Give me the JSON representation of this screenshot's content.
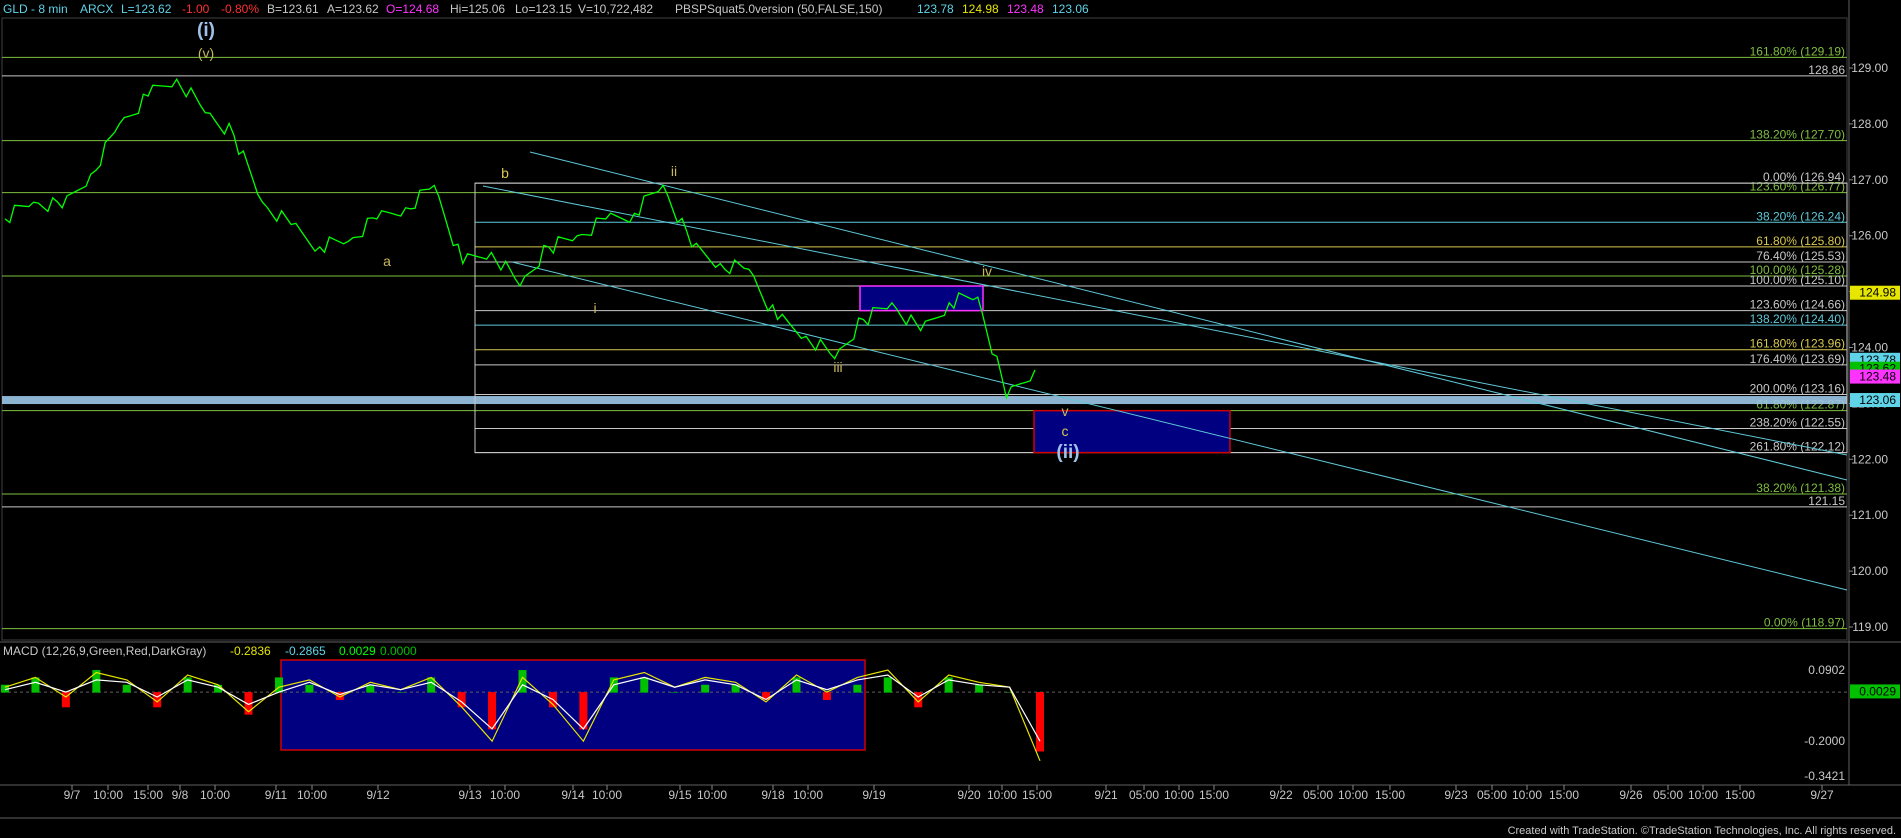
{
  "header": {
    "symbol": "GLD - 8 min",
    "exchange": "ARCX",
    "last": "L=123.62",
    "change": "-1.00",
    "change_pct": "-0.80%",
    "bid": "B=123.61",
    "ask": "A=123.62",
    "open": "O=124.68",
    "high": "Hi=125.06",
    "low": "Lo=123.15",
    "volume": "V=10,722,482",
    "indicator": "PBSPSquat5.0version (50,FALSE,150)",
    "ind_values": [
      {
        "text": "123.78",
        "color": "#5fd3e8"
      },
      {
        "text": "124.98",
        "color": "#e6e600"
      },
      {
        "text": "123.48",
        "color": "#ff33ff"
      },
      {
        "text": "123.06",
        "color": "#5fd3e8"
      }
    ]
  },
  "macd_header": {
    "label": "MACD (12,26,9,Green,Red,DarkGray)",
    "v1": "-0.2836",
    "v2": "-0.2865",
    "v3": "0.0029",
    "v4": "0.0000"
  },
  "footer": "Created with TradeStation. ©TradeStation Technologies, Inc. All rights reserved.",
  "colors": {
    "price": "#00ff00",
    "fib_green": "#7fbf3f",
    "fib_white": "#c8c8c8",
    "channel": "#5fc8d8",
    "wave_label": "#d8c850",
    "major_label": "#9fc0e8",
    "blue_box": "#000080",
    "box_border": "#d00000"
  },
  "chart_data": [
    {
      "type": "line",
      "title": "GLD - 8 min",
      "x_tick_labels": [
        "9/7",
        "10:00",
        "15:00",
        "9/8",
        "10:00",
        "9/11",
        "10:00",
        "9/12",
        "9/13",
        "10:00",
        "9/14",
        "10:00",
        "9/15",
        "10:00",
        "9/18",
        "10:00",
        "9/19",
        "9/20",
        "10:00",
        "15:00",
        "9/21",
        "05:00",
        "10:00",
        "15:00",
        "9/22",
        "05:00",
        "10:00",
        "15:00",
        "9/23",
        "05:00",
        "10:00",
        "15:00",
        "9/26",
        "05:00",
        "10:00",
        "15:00",
        "9/27"
      ],
      "y_ticks": [
        "129.00",
        "128.00",
        "127.00",
        "126.00",
        "125.00",
        "124.00",
        "123.00",
        "122.00",
        "121.00",
        "120.00",
        "119.00"
      ],
      "ylim": [
        118.8,
        129.6
      ],
      "series": [
        {
          "values": [
            126.3,
            126.6,
            126.5,
            127.1,
            128.0,
            128.5,
            128.8,
            128.2,
            127.8,
            126.6,
            126.2,
            125.8,
            125.9,
            126.3,
            126.5,
            126.9,
            125.5,
            125.7,
            125.1,
            125.8,
            126.0,
            126.3,
            126.4,
            126.9,
            125.8,
            125.5,
            125.4,
            124.5,
            124.2,
            123.8,
            124.5,
            124.8,
            124.3,
            124.8,
            124.9,
            123.1,
            123.6
          ]
        }
      ],
      "fib_levels": [
        {
          "label": "161.80% (129.19)",
          "value": 129.19,
          "color": "#7fbf3f"
        },
        {
          "label": "128.86",
          "value": 128.86,
          "color": "#c8c8c8"
        },
        {
          "label": "138.20% (127.70)",
          "value": 127.7,
          "color": "#7fbf3f"
        },
        {
          "label": "0.00% (126.94)",
          "value": 126.94,
          "color": "#c8c8c8"
        },
        {
          "label": "123.60% (126.77)",
          "value": 126.77,
          "color": "#7fbf3f"
        },
        {
          "label": "38.20% (126.24)",
          "value": 126.24,
          "color": "#5fc8d8"
        },
        {
          "label": "61.80% (125.80)",
          "value": 125.8,
          "color": "#d8c850"
        },
        {
          "label": "76.40% (125.53)",
          "value": 125.53,
          "color": "#c8c8c8"
        },
        {
          "label": "100.00% (125.28)",
          "value": 125.28,
          "color": "#7fbf3f"
        },
        {
          "label": "100.00% (125.10)",
          "value": 125.1,
          "color": "#c8c8c8"
        },
        {
          "label": "123.60% (124.66)",
          "value": 124.66,
          "color": "#c8c8c8"
        },
        {
          "label": "138.20% (124.40)",
          "value": 124.4,
          "color": "#5fc8d8"
        },
        {
          "label": "161.80% (123.96)",
          "value": 123.96,
          "color": "#d8c850"
        },
        {
          "label": "176.40% (123.69)",
          "value": 123.69,
          "color": "#c8c8c8"
        },
        {
          "label": "200.00% (123.16)",
          "value": 123.16,
          "color": "#c8c8c8"
        },
        {
          "label": "61.80% (122.87)",
          "value": 122.87,
          "color": "#7fbf3f"
        },
        {
          "label": "238.20% (122.55)",
          "value": 122.55,
          "color": "#c8c8c8"
        },
        {
          "label": "261.80% (122.12)",
          "value": 122.12,
          "color": "#c8c8c8"
        },
        {
          "label": "38.20% (121.38)",
          "value": 121.38,
          "color": "#7fbf3f"
        },
        {
          "label": "121.15",
          "value": 121.15,
          "color": "#c8c8c8"
        },
        {
          "label": "0.00% (118.97)",
          "value": 118.97,
          "color": "#7fbf3f"
        }
      ],
      "price_tags": [
        {
          "text": "124.98",
          "value": 124.98,
          "bg": "#e6e600"
        },
        {
          "text": "123.78",
          "value": 123.78,
          "bg": "#5fd3e8"
        },
        {
          "text": "123.62",
          "value": 123.62,
          "bg": "#00c000"
        },
        {
          "text": "123.48",
          "value": 123.48,
          "bg": "#ff33ff"
        },
        {
          "text": "123.06",
          "value": 123.06,
          "bg": "#5fd3e8"
        }
      ],
      "wave_labels": [
        {
          "text": "(i)",
          "major": true
        },
        {
          "text": "(v)",
          "major": false
        },
        {
          "text": "a",
          "major": false
        },
        {
          "text": "b",
          "major": false
        },
        {
          "text": "i",
          "major": false
        },
        {
          "text": "ii",
          "major": false
        },
        {
          "text": "iii",
          "major": false
        },
        {
          "text": "iv",
          "major": false
        },
        {
          "text": "v",
          "major": false
        },
        {
          "text": "c",
          "major": false
        },
        {
          "text": "(ii)",
          "major": true
        }
      ]
    },
    {
      "type": "line",
      "title": "MACD (12,26,9,Green,Red,DarkGray)",
      "y_ticks": [
        "0.0902",
        "-0.2000",
        "-0.3421"
      ],
      "ylim": [
        -0.36,
        0.16
      ],
      "current_tag": "0.0029",
      "series": [
        {
          "name": "MACD",
          "values": [
            0.02,
            0.06,
            -0.02,
            0.08,
            0.05,
            -0.04,
            0.07,
            0.03,
            -0.08,
            0.02,
            0.05,
            -0.02,
            0.04,
            0.01,
            0.06,
            -0.06,
            -0.2,
            0.06,
            -0.05,
            -0.2,
            0.05,
            0.08,
            0.02,
            0.06,
            0.04,
            -0.04,
            0.07,
            0.0,
            0.06,
            0.09,
            -0.04,
            0.07,
            0.04,
            0.02,
            -0.28
          ]
        },
        {
          "name": "Signal",
          "values": [
            0.01,
            0.04,
            0.0,
            0.05,
            0.04,
            -0.02,
            0.05,
            0.02,
            -0.05,
            0.0,
            0.04,
            -0.01,
            0.03,
            0.01,
            0.04,
            -0.04,
            -0.15,
            0.03,
            -0.03,
            -0.15,
            0.03,
            0.06,
            0.02,
            0.05,
            0.03,
            -0.03,
            0.05,
            0.01,
            0.05,
            0.07,
            -0.02,
            0.05,
            0.03,
            0.02,
            -0.2
          ]
        }
      ]
    }
  ]
}
